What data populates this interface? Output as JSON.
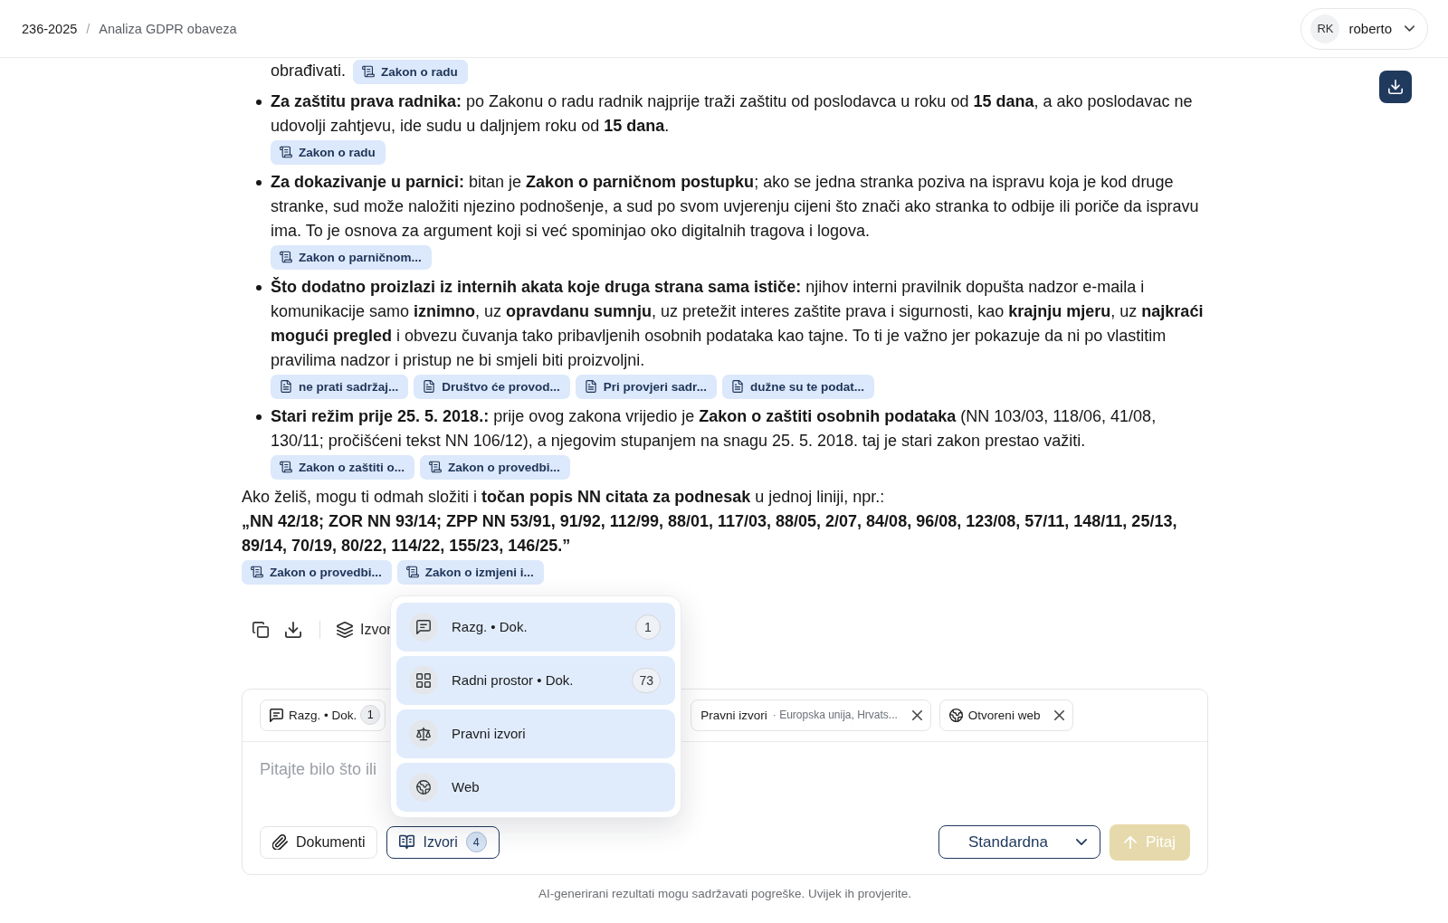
{
  "header": {
    "breadcrumb": [
      {
        "label": "236-2025"
      },
      {
        "label": "Analiza GDPR obaveza"
      }
    ],
    "separator": "/",
    "user": {
      "initials": "RK",
      "name": "roberto"
    }
  },
  "message": {
    "blocks": [
      {
        "kind": "fragment",
        "text": "obrađivati.",
        "citations": [
          {
            "kind": "law",
            "label": "Zakon o radu"
          }
        ]
      },
      {
        "kind": "bullet",
        "text": "**Za zaštitu prava radnika:** po Zakonu o radu radnik najprije traži zaštitu od poslodavca u roku od **15 dana**, a ako poslodavac ne udovolji zahtjevu, ide sudu u daljnjem roku od **15 dana**.",
        "citations": [
          {
            "kind": "law",
            "label": "Zakon o radu"
          }
        ]
      },
      {
        "kind": "bullet",
        "text": "**Za dokazivanje u parnici:** bitan je **Zakon o parničnom postupku**; ako se jedna stranka poziva na ispravu koja je kod druge stranke, sud može naložiti njezino podnošenje, a sud po svom uvjerenju cijeni što znači ako stranka to odbije ili poriče da ispravu ima. To je osnova za argument koji si već spominjao oko digitalnih tragova i logova.",
        "citations": [
          {
            "kind": "law",
            "label": "Zakon o parničnom..."
          }
        ]
      },
      {
        "kind": "bullet",
        "text": "**Što dodatno proizlazi iz internih akata koje druga strana sama ističe:** njihov interni pravilnik dopušta nadzor e-maila i komunikacije samo **iznimno**, uz **opravdanu sumnju**, uz pretežit interes zaštite prava i sigurnosti, kao **krajnju mjeru**, uz **najkraći mogući pregled** i obvezu čuvanja tako pribavljenih osobnih podataka kao tajne. To ti je važno jer pokazuje da ni po vlastitim pravilima nadzor i pristup ne bi smjeli biti proizvoljni.",
        "citations": [
          {
            "kind": "document",
            "label": "ne prati sadržaj..."
          },
          {
            "kind": "document",
            "label": "Društvo će provod..."
          },
          {
            "kind": "document",
            "label": "Pri provjeri sadr..."
          },
          {
            "kind": "document",
            "label": "dužne su te podat..."
          }
        ]
      },
      {
        "kind": "bullet",
        "text": "**Stari režim prije 25. 5. 2018.:** prije ovog zakona vrijedio je **Zakon o zaštiti osobnih podataka** (NN 103/03, 118/06, 41/08, 130/11; pročišćeni tekst NN 106/12), a njegovim stupanjem na snagu 25. 5. 2018. taj je stari zakon prestao važiti.",
        "citations": [
          {
            "kind": "law",
            "label": "Zakon o zaštiti o..."
          },
          {
            "kind": "law",
            "label": "Zakon o provedbi..."
          }
        ]
      },
      {
        "kind": "paragraph",
        "text": "Ako želiš, mogu ti odmah složiti i **točan popis NN citata za podnesak** u jednoj liniji, npr.:",
        "quote": "„NN 42/18; ZOR NN 93/14; ZPP NN 53/91, 91/92, 112/99, 88/01, 117/03, 88/05, 2/07, 84/08, 96/08, 123/08, 57/11, 148/11, 25/13, 89/14, 70/19, 80/22, 114/22, 155/23, 146/25.”",
        "citations": [
          {
            "kind": "law",
            "label": "Zakon o provedbi..."
          },
          {
            "kind": "law",
            "label": "Zakon o izmjeni i..."
          }
        ]
      }
    ]
  },
  "message_actions": {
    "sources_label": "Izvor"
  },
  "sources_menu": {
    "open": true,
    "items": [
      {
        "kind": "chat",
        "label": "Razg. • Dok.",
        "count": "1",
        "selected": true
      },
      {
        "kind": "workspace",
        "label": "Radni prostor • Dok.",
        "count": "73",
        "selected": true
      },
      {
        "kind": "legal",
        "label": "Pravni izvori",
        "selected": true
      },
      {
        "kind": "web",
        "label": "Web",
        "selected": true
      }
    ]
  },
  "composer": {
    "chips": [
      {
        "kind": "chat",
        "label": "Razg. • Dok.",
        "count": "1",
        "removable": false
      },
      {
        "label": "Pravni izvori",
        "detail": "· Europska unija, Hrvats...",
        "removable": true
      },
      {
        "kind": "web",
        "label": "Otvoreni web",
        "removable": true
      }
    ],
    "placeholder": "Pitajte bilo što ili",
    "attach_button": {
      "label": "Dokumenti"
    },
    "sources_button": {
      "label": "Izvori",
      "count": "4"
    },
    "mode_select": {
      "value": "Standardna"
    },
    "send_button": {
      "label": "Pitaj",
      "disabled": true
    }
  },
  "disclaimer": "AI-generirani rezultati mogu sadržavati pogreške. Uvijek ih provjerite."
}
